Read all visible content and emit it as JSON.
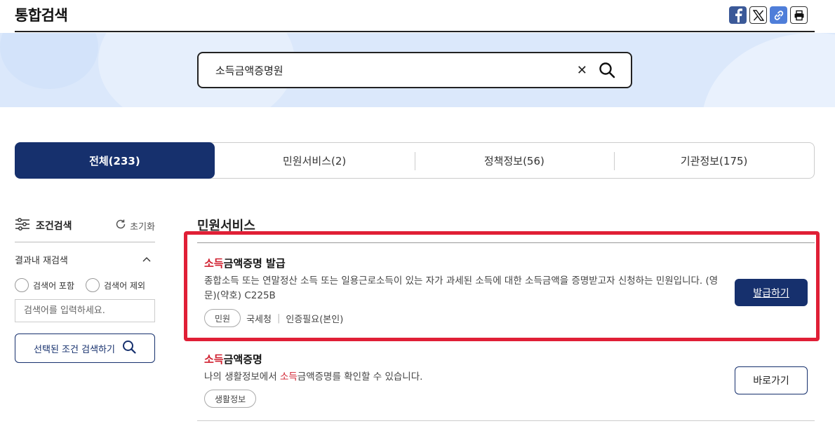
{
  "header": {
    "title": "통합검색",
    "share_icons": [
      "facebook-icon",
      "x-icon",
      "link-icon",
      "print-icon"
    ]
  },
  "search": {
    "value": "소득금액증명원"
  },
  "tabs": [
    {
      "label": "전체(233)",
      "active": true
    },
    {
      "label": "민원서비스(2)",
      "active": false
    },
    {
      "label": "정책정보(56)",
      "active": false
    },
    {
      "label": "기관정보(175)",
      "active": false
    }
  ],
  "sidebar": {
    "title": "조건검색",
    "reset_label": "초기화",
    "subsection": "결과내 재검색",
    "radio_include": "검색어 포함",
    "radio_exclude": "검색어 제외",
    "input_placeholder": "검색어를 입력하세요.",
    "search_button": "선택된 조건 검색하기"
  },
  "results": {
    "section_title": "민원서비스",
    "items": [
      {
        "title_highlight": "소득",
        "title_rest": "금액증명 발급",
        "desc_line1": "종합소득 또는 연말정산 소득 또는 일용근로소득이 있는 자가 과세된 소득에 대한 소득금액을 증명받고자 신청하는 민원입니다. (영",
        "desc_line2": "문)(약호) C225B",
        "chip": "민원",
        "agency": "국세청",
        "auth": "인증필요(본인)",
        "button": "발급하기"
      },
      {
        "title_highlight": "소득",
        "title_rest": "금액증명",
        "desc_prefix": "나의 생활정보에서 ",
        "desc_highlight": "소득",
        "desc_suffix": "금액증명를 확인할 수 있습니다.",
        "chip": "생활정보",
        "button": "바로가기"
      }
    ]
  },
  "colors": {
    "primary": "#16306d",
    "highlight": "#d0202f",
    "annotation_box": "#e01f36",
    "banner": "#dbe8fb"
  }
}
